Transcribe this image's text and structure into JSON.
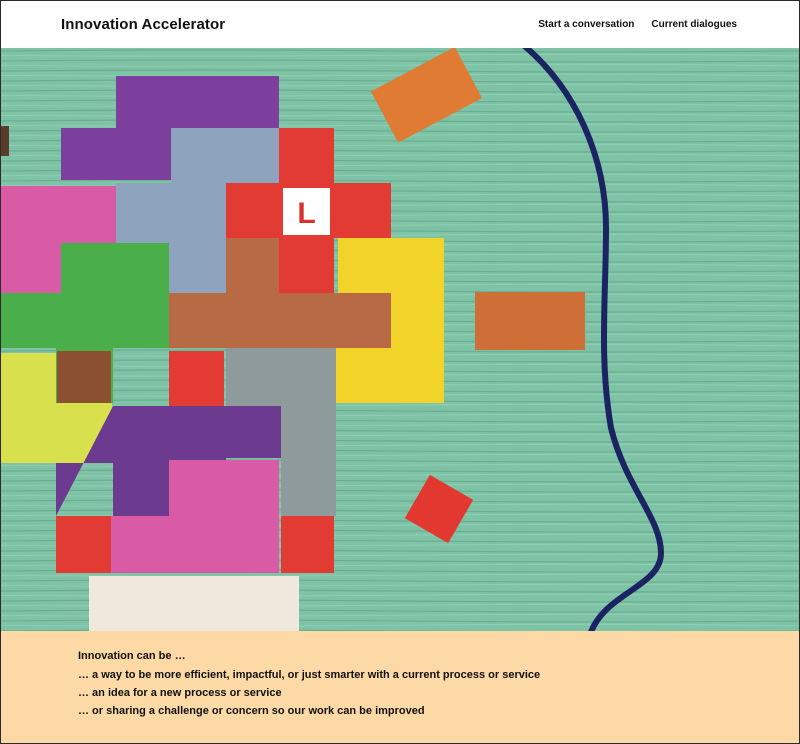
{
  "header": {
    "title": "Innovation Accelerator",
    "nav": [
      {
        "label": "Start a conversation"
      },
      {
        "label": "Current dialogues"
      }
    ]
  },
  "hero": {
    "logo_glyph": "L",
    "colors": {
      "wood_green": "#7cc1a5",
      "head_outline": "#1c2363",
      "logo_red": "#e8392f"
    }
  },
  "intro": {
    "heading": "Innovation can be …",
    "lines": [
      "… a way to be more efficient, impactful, or just smarter with a current process or service",
      "… an idea for a new process or service",
      "… or sharing a challenge or concern so our work can be improved"
    ]
  }
}
